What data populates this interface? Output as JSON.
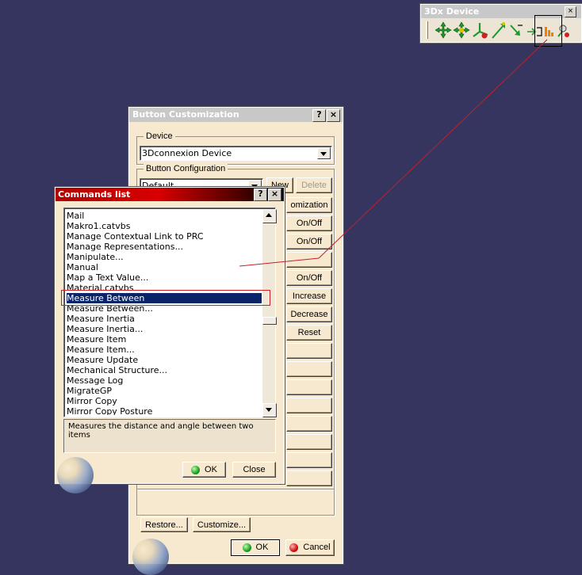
{
  "toolbar": {
    "title": "3Dx Device",
    "close": "×",
    "icons": [
      "pan-icon",
      "rotate-icon",
      "axis-icon",
      "zoom-icon",
      "spin-icon",
      "dominant-icon",
      "sensitivity-icon",
      "customize-icon"
    ]
  },
  "button_customization": {
    "title": "Button Customization",
    "help": "?",
    "close": "×",
    "device_label": "Device",
    "device_value": "3Dconnexion Device",
    "config_label": "Button Configuration",
    "config_value": "Default",
    "new_label": "New",
    "delete_label": "Delete",
    "assignments": [
      "omization",
      "On/Off",
      "On/Off",
      "",
      "On/Off",
      "Increase",
      "Decrease",
      "Reset"
    ],
    "restore_label": "Restore...",
    "customize_label": "Customize...",
    "ok_label": "OK",
    "cancel_label": "Cancel"
  },
  "commands_list": {
    "title": "Commands list",
    "help": "?",
    "close": "×",
    "items": [
      "Mail",
      "Makro1.catvbs",
      "Manage Contextual Link to PRC",
      "Manage Representations...",
      "Manipulate...",
      "Manual",
      "Map a Text Value...",
      "Material.catvbs",
      "Measure Between",
      "Measure Between...",
      "Measure Inertia",
      "Measure Inertia...",
      "Measure Item",
      "Measure Item...",
      "Measure Update",
      "Mechanical Structure...",
      "Message Log",
      "MigrateGP",
      "Mirror Copy",
      "Mirror Copy Posture"
    ],
    "selected_index": 8,
    "description": "Measures the distance and angle between two items",
    "ok_label": "OK",
    "close_label": "Close"
  }
}
